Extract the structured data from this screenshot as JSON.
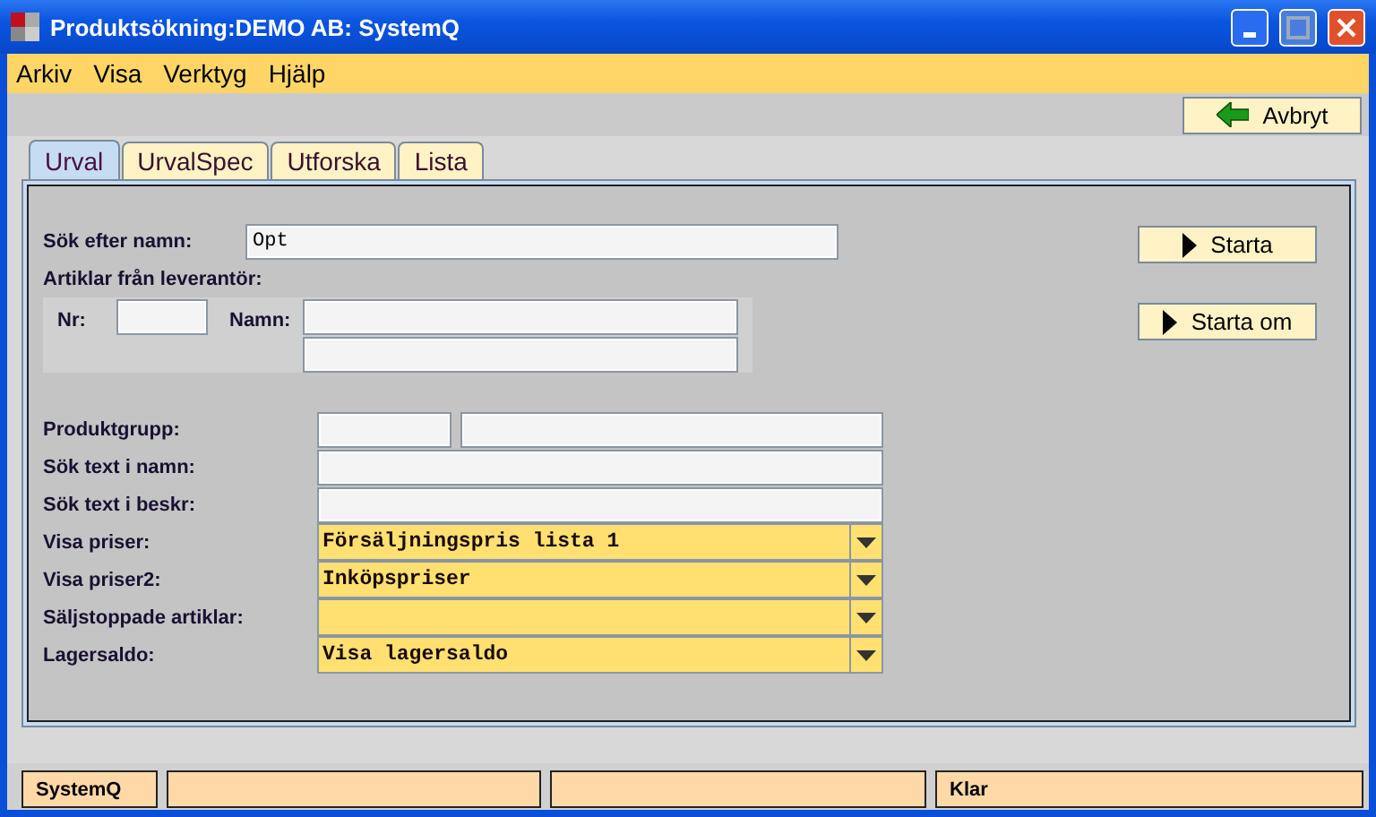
{
  "window": {
    "title": "Produktsökning:DEMO AB: SystemQ"
  },
  "menu": [
    "Arkiv",
    "Visa",
    "Verktyg",
    "Hjälp"
  ],
  "toolbar": {
    "cancel_button": "Avbryt"
  },
  "tabs": [
    {
      "label": "Urval",
      "selected": true
    },
    {
      "label": "UrvalSpec",
      "selected": false
    },
    {
      "label": "Utforska",
      "selected": false
    },
    {
      "label": "Lista",
      "selected": false
    }
  ],
  "form": {
    "search_name": {
      "label": "Sök efter namn:",
      "value": "Opt"
    },
    "supplier": {
      "label": "Artiklar från leverantör:",
      "nr_label": "Nr:",
      "name_label": "Namn:"
    },
    "fields": [
      {
        "kind": "pair",
        "label": "Produktgrupp:"
      },
      {
        "kind": "text",
        "label": "Sök text i namn:"
      },
      {
        "kind": "text",
        "label": "Sök text i beskr:"
      },
      {
        "kind": "select",
        "label": "Visa priser:",
        "value": "Försäljningspris lista 1"
      },
      {
        "kind": "select",
        "label": "Visa priser2:",
        "value": "Inköpspriser"
      },
      {
        "kind": "select",
        "label": "Säljstoppade artiklar:"
      },
      {
        "kind": "select",
        "label": "Lagersaldo:",
        "value": "Visa lagersaldo"
      }
    ]
  },
  "actions": [
    "Starta",
    "Starta om"
  ],
  "status_bar": {
    "app": "SystemQ",
    "state": "Klar"
  }
}
